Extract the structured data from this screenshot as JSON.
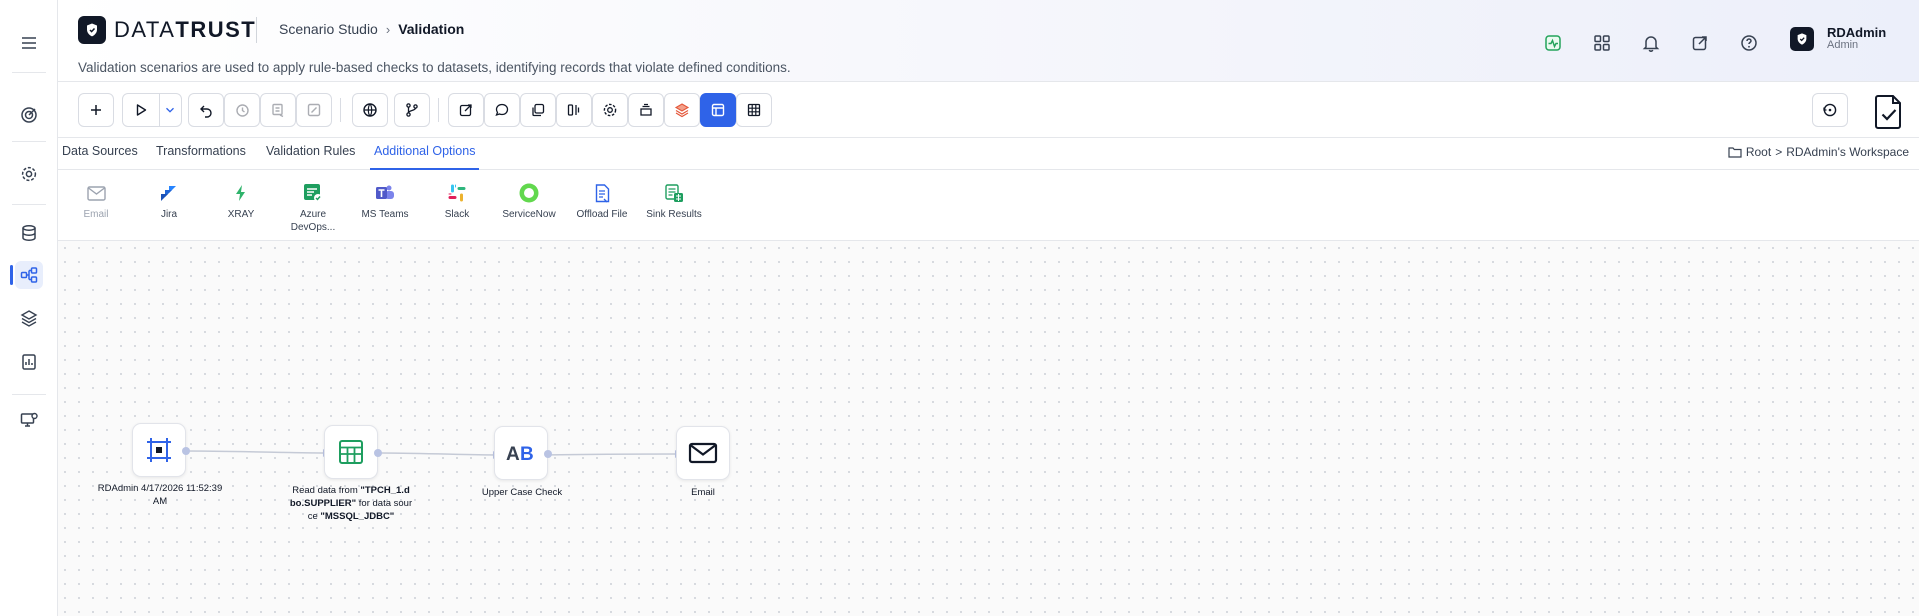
{
  "app": {
    "logo_text_light": "DATA",
    "logo_text_bold": "TRUST"
  },
  "header": {
    "breadcrumb_parent": "Scenario Studio",
    "breadcrumb_current": "Validation",
    "description": "Validation scenarios are used to apply rule-based checks to datasets, identifying records that violate defined conditions.",
    "icons": [
      "activity-icon",
      "apps-grid-icon",
      "bell-icon",
      "external-link-icon",
      "help-icon"
    ],
    "accent_color": "#22a35a"
  },
  "user": {
    "name": "RDAdmin",
    "role": "Admin"
  },
  "sidebar": {
    "items": [
      "menu-icon",
      "target-icon",
      "settings-icon",
      "database-icon",
      "workflow-icon",
      "layers-icon",
      "report-icon",
      "monitor-icon"
    ],
    "active": "workflow-icon"
  },
  "toolbar": {
    "buttons": [
      "add",
      "run",
      "run-options",
      "undo",
      "history",
      "save-disabled",
      "edit-disabled",
      "globe",
      "branch",
      "export",
      "comment",
      "copy",
      "split",
      "settings",
      "stack",
      "layers",
      "layout-active",
      "table"
    ],
    "primary_color": "#2f63e8"
  },
  "tabs": {
    "items": [
      {
        "label": "Data Sources"
      },
      {
        "label": "Transformations"
      },
      {
        "label": "Validation Rules"
      },
      {
        "label": "Additional Options"
      }
    ],
    "active_index": 3
  },
  "workspace": {
    "root": "Root",
    "separator": ">",
    "name": "RDAdmin's Workspace"
  },
  "options": {
    "items": [
      {
        "label": "Email",
        "icon": "mail-icon",
        "enabled": false
      },
      {
        "label": "Jira",
        "icon": "jira-icon",
        "enabled": true
      },
      {
        "label": "XRAY",
        "icon": "xray-icon",
        "enabled": true
      },
      {
        "label": "Azure DevOps...",
        "label_line1": "Azure",
        "label_line2": "DevOps...",
        "icon": "azure-devops-icon",
        "enabled": true
      },
      {
        "label": "MS Teams",
        "icon": "ms-teams-icon",
        "enabled": true
      },
      {
        "label": "Slack",
        "icon": "slack-icon",
        "enabled": true
      },
      {
        "label": "ServiceNow",
        "icon": "servicenow-icon",
        "enabled": true
      },
      {
        "label": "Offload File",
        "icon": "offload-file-icon",
        "enabled": true
      },
      {
        "label": "Sink Results",
        "icon": "sink-results-icon",
        "enabled": true
      }
    ]
  },
  "flow": {
    "nodes": [
      {
        "icon": "start-node-icon",
        "label_line1": "RDAdmin 4/17/2026 11:52:39",
        "label_line2": "AM"
      },
      {
        "icon": "table-source-icon",
        "label_pre": "Read data from ",
        "label_b1": "\"TPCH_1.d",
        "label_b2": "bo.SUPPLIER\"",
        "label_mid": " for data sour",
        "label_post": "ce ",
        "label_b3": "\"MSSQL_JDBC\""
      },
      {
        "icon": "uppercase-check-icon",
        "label": "Upper Case Check"
      },
      {
        "icon": "email-node-icon",
        "label": "Email"
      }
    ]
  }
}
